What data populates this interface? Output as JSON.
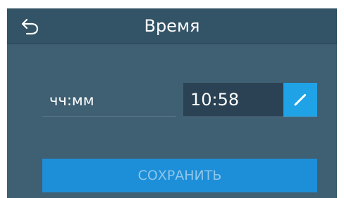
{
  "header": {
    "title": "Время",
    "back_icon": "back-arrow-icon"
  },
  "time_entry": {
    "label": "чч:мм",
    "value": "10:58",
    "edit_icon": "pencil-icon"
  },
  "actions": {
    "save_label": "СОХРАНИТЬ"
  },
  "colors": {
    "background": "#3f5f72",
    "header": "#335366",
    "field": "#2a4253",
    "accent": "#1fa2e6",
    "save_button": "#1d8fd8",
    "save_text": "#8fc6ea"
  }
}
